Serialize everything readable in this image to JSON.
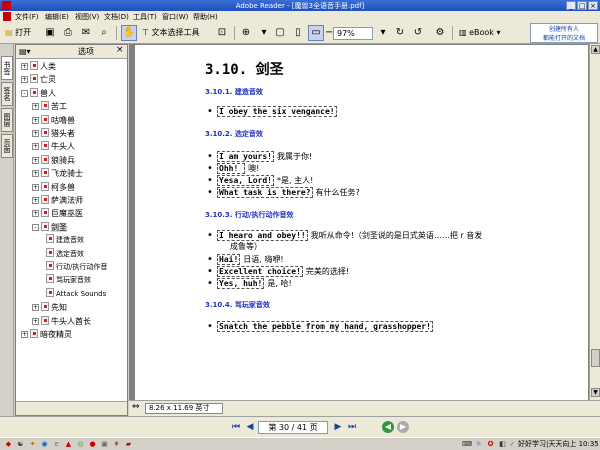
{
  "window": {
    "title": "Adobe Reader - [魔兽3全语音手册.pdf]"
  },
  "menu": [
    "文件(F)",
    "编辑(E)",
    "视图(V)",
    "文档(D)",
    "工具(T)",
    "窗口(W)",
    "帮助(H)"
  ],
  "toolbar": {
    "open_label": "打开",
    "text_select_label": "文本选择工具",
    "zoom_value": "97%",
    "ebook_label": "eBook",
    "help_line1": "创建所有人",
    "help_line2": "都能打开的文档"
  },
  "vtabs": [
    "书签",
    "签名",
    "图层",
    "页面"
  ],
  "panel": {
    "title": "选项"
  },
  "bookmarks": [
    {
      "label": "人类",
      "expand": "+"
    },
    {
      "label": "亡灵",
      "expand": "+"
    },
    {
      "label": "兽人",
      "expand": "-"
    },
    {
      "label": "苦工",
      "expand": "+"
    },
    {
      "label": "咕噜兽",
      "expand": "+"
    },
    {
      "label": "猎头者",
      "expand": "+"
    },
    {
      "label": "牛头人",
      "expand": "+"
    },
    {
      "label": "狼骑兵",
      "expand": "+"
    },
    {
      "label": "飞龙骑士",
      "expand": "+"
    },
    {
      "label": "柯多兽",
      "expand": "+"
    },
    {
      "label": "萨满法师",
      "expand": "+"
    },
    {
      "label": "巨魔巫医",
      "expand": "+"
    },
    {
      "label": "剑圣",
      "expand": "-"
    },
    {
      "label": "建造音效",
      "expand": ""
    },
    {
      "label": "选定音效",
      "expand": ""
    },
    {
      "label": "行动/执行动作音",
      "expand": ""
    },
    {
      "label": "骂玩家音效",
      "expand": ""
    },
    {
      "label": "Attack Sounds",
      "expand": ""
    },
    {
      "label": "先知",
      "expand": "+"
    },
    {
      "label": "牛头人酋长",
      "expand": "+"
    },
    {
      "label": "暗夜精灵",
      "expand": "+"
    }
  ],
  "document": {
    "heading": "3.10. 剑圣",
    "sections": [
      {
        "title": "3.10.1. 建造音效",
        "items": [
          {
            "en": "I obey the six vengance!",
            "cn": ""
          }
        ]
      },
      {
        "title": "3.10.2. 选定音效",
        "items": [
          {
            "en": "I am yours!",
            "cn": "我属于你!"
          },
          {
            "en": "Ohh! ",
            "cn": "噢!"
          },
          {
            "en": "Yesa, Lord!",
            "cn": "*是, 主人!"
          },
          {
            "en": "What task is there?",
            "cn": "有什么任务?"
          }
        ]
      },
      {
        "title": "3.10.3. 行动/执行动作音效",
        "items": [
          {
            "en": "I hearo and obey!!",
            "cn": "我听从命令!（剑圣说的是日式英语……把 r 音发"
          },
          {
            "en": "Hai!",
            "cn": "日语, 嗨咿!"
          },
          {
            "en": "Excellent choice!",
            "cn": "完美的选择!"
          },
          {
            "en": "Yes, huh!",
            "cn": "是, 哈!"
          }
        ],
        "continuation": "成鲁等）"
      },
      {
        "title": "3.10.4. 骂玩家音效",
        "items": [
          {
            "en": "Snatch the pebble from my hand, grasshopper!",
            "cn": ""
          }
        ]
      }
    ],
    "page_size": "8.26 x 11.69 英寸"
  },
  "navigation": {
    "page_text": "第 30 / 41 页"
  },
  "taskbar": {
    "tray_text": "好好学习|天天向上 10:35"
  }
}
